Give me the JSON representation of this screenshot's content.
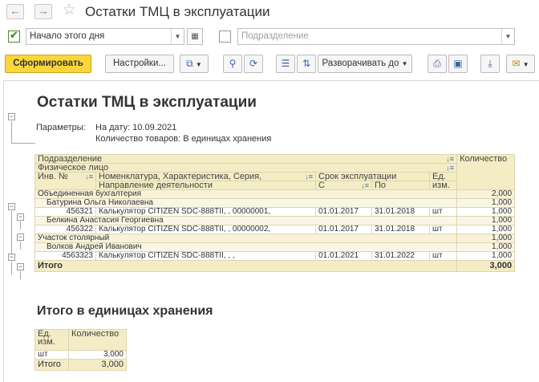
{
  "window": {
    "title": "Остатки ТМЦ в эксплуатации",
    "back": "←",
    "forward": "→",
    "star": "☆"
  },
  "filters": {
    "date_enabled": true,
    "date_value": "Начало этого дня",
    "department_enabled": false,
    "department_placeholder": "Подразделение"
  },
  "toolbar": {
    "generate": "Сформировать",
    "settings": "Настройки...",
    "expand_to": "Разворачивать до"
  },
  "report": {
    "title": "Остатки ТМЦ в эксплуатации",
    "params_label": "Параметры:",
    "param_date": "На дату: 10.09.2021",
    "param_units": "Количество товаров: В единицах хранения",
    "headers": {
      "department": "Подразделение",
      "person": "Физическое лицо",
      "inv_no": "Инв. №",
      "nomenclature": "Номенклатура, Характеристика, Серия,",
      "direction": "Направление деятельности",
      "service_life": "Срок эксплуатации",
      "from": "С",
      "to": "По",
      "unit": "Ед.",
      "unit2": "изм.",
      "quantity": "Количество"
    },
    "rows": [
      {
        "type": "grp",
        "label": "Объединенная бухгалтерия",
        "qty": "2,000"
      },
      {
        "type": "sub",
        "label": "Батурина Ольга Николаевна",
        "qty": "1,000"
      },
      {
        "type": "det",
        "inv": "456321",
        "item": "Калькулятор CITIZEN SDC-888TII, , 00000001,",
        "from": "01.01.2017",
        "to": "31.01.2018",
        "unit": "шт",
        "qty": "1,000"
      },
      {
        "type": "sub",
        "label": "Белкина Анастасия Георгиевна",
        "qty": "1,000"
      },
      {
        "type": "det",
        "inv": "456322",
        "item": "Калькулятор CITIZEN SDC-888TII, , 00000002,",
        "from": "01.01.2017",
        "to": "31.01.2018",
        "unit": "шт",
        "qty": "1,000"
      },
      {
        "type": "grp",
        "label": "Участок столярный",
        "qty": "1,000"
      },
      {
        "type": "sub",
        "label": "Волков Андрей Иванович",
        "qty": "1,000"
      },
      {
        "type": "det",
        "inv": "4563323",
        "item": "Калькулятор CITIZEN SDC-888TII, , ,",
        "from": "01.01.2021",
        "to": "31.01.2022",
        "unit": "шт",
        "qty": "1,000"
      }
    ],
    "total_label": "Итого",
    "total_qty": "3,000",
    "summary_title": "Итого в единицах хранения",
    "summary": {
      "unit_h1": "Ед.",
      "unit_h2": "изм.",
      "qty_h": "Количество",
      "unit": "шт",
      "qty": "3,000",
      "total_label": "Итого",
      "total_qty": "3,000"
    }
  }
}
